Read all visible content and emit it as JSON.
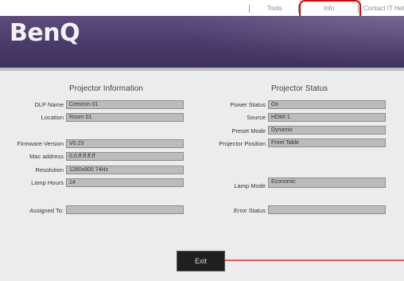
{
  "topnav": {
    "tools": "Tools",
    "info": "Info",
    "contact": "Contact IT Help"
  },
  "brand": {
    "logo": "BenQ"
  },
  "projector_info": {
    "heading": "Projector Information",
    "fields": [
      {
        "label": "DLP Name",
        "value": "Crestron 01"
      },
      {
        "label": "Location",
        "value": "Room 01"
      },
      {
        "label": "Firmware Version",
        "value": "V0.23"
      },
      {
        "label": "Mac address",
        "value": "0.0.ff.ff.ff.ff"
      },
      {
        "label": "Resolution",
        "value": "1280x800 74Hz"
      },
      {
        "label": "Lamp Hours",
        "value": "14"
      },
      {
        "label": "Assigned To:",
        "value": ""
      }
    ]
  },
  "projector_status": {
    "heading": "Projector Status",
    "fields": [
      {
        "label": "Power Status",
        "value": "On"
      },
      {
        "label": "Source",
        "value": "HDMI 1"
      },
      {
        "label": "Preset Mode",
        "value": "Dynamic"
      },
      {
        "label": "Projector Position",
        "value": "Front Table"
      },
      {
        "label": "Lamp Mode",
        "value": "Economic"
      },
      {
        "label": "Error Status",
        "value": ""
      }
    ]
  },
  "exit_button": {
    "label": "Exit"
  },
  "colors": {
    "banner": "#4a3a6a",
    "highlight": "#e00000",
    "arrow": "#e25a5a"
  }
}
